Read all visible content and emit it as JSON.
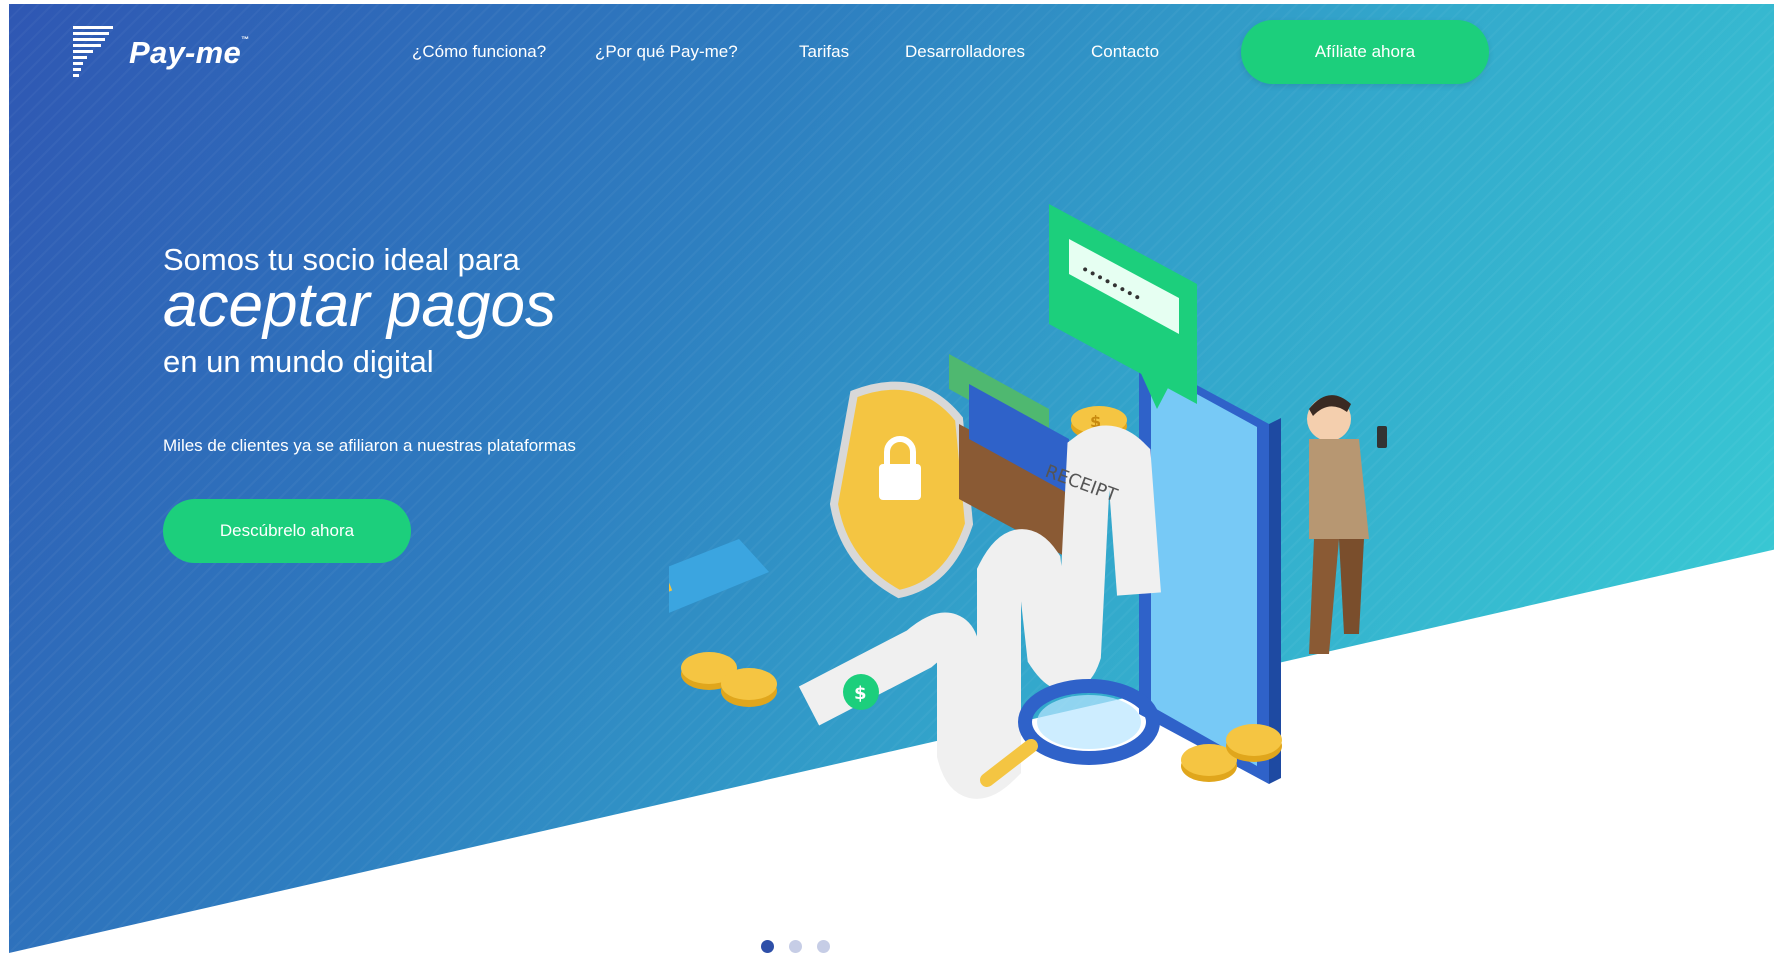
{
  "brand": {
    "name": "Pay-me",
    "trademark": "™"
  },
  "nav": {
    "items": [
      {
        "label": "¿Cómo funciona?"
      },
      {
        "label": "¿Por qué Pay-me?"
      },
      {
        "label": "Tarifas"
      },
      {
        "label": "Desarrolladores"
      },
      {
        "label": "Contacto"
      }
    ],
    "cta_label": "Afíliate ahora"
  },
  "hero": {
    "line1": "Somos tu socio ideal para",
    "line2": "aceptar pagos",
    "line3": "en un mundo digital",
    "subtitle": "Miles de clientes ya se afiliaron a nuestras plataformas",
    "cta_label": "Descúbrelo ahora"
  },
  "illustration": {
    "receipt_label": "RECEIPT",
    "dollar_sign": "$"
  },
  "carousel": {
    "dots": 3,
    "active_index": 0
  },
  "colors": {
    "accent": "#1ccf7c",
    "gradient_start": "#2f57b3",
    "gradient_end": "#3ad2d6"
  }
}
